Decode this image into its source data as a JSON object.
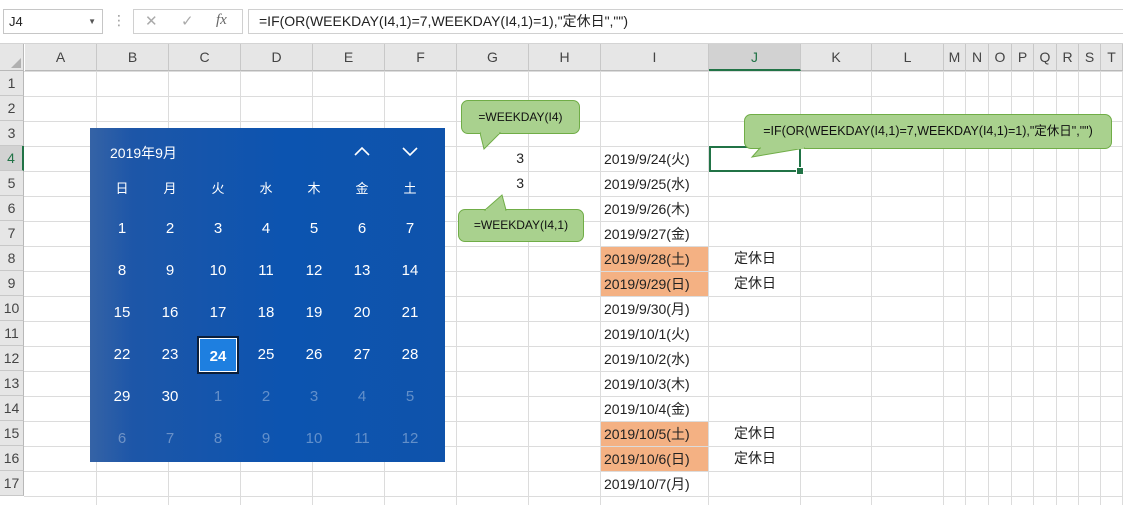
{
  "formula_bar": {
    "name_box": "J4",
    "sep": "⋮",
    "cancel": "✕",
    "enter": "✓",
    "fx": "fx",
    "formula": "=IF(OR(WEEKDAY(I4,1)=7,WEEKDAY(I4,1)=1),\"定休日\",\"\")"
  },
  "columns": [
    "A",
    "B",
    "C",
    "D",
    "E",
    "F",
    "G",
    "H",
    "I",
    "J",
    "K",
    "L",
    "M",
    "N",
    "O",
    "P",
    "Q",
    "R",
    "S",
    "T"
  ],
  "rows": [
    "1",
    "2",
    "3",
    "4",
    "5",
    "6",
    "7",
    "8",
    "9",
    "10",
    "11",
    "12",
    "13",
    "14",
    "15",
    "16",
    "17"
  ],
  "selected_cell": "J4",
  "cells": {
    "G4": "3",
    "G5": "3",
    "dates": [
      "2019/9/24(火)",
      "2019/9/25(水)",
      "2019/9/26(木)",
      "2019/9/27(金)",
      "2019/9/28(土)",
      "2019/9/29(日)",
      "2019/9/30(月)",
      "2019/10/1(火)",
      "2019/10/2(水)",
      "2019/10/3(木)",
      "2019/10/4(金)",
      "2019/10/5(土)",
      "2019/10/6(日)",
      "2019/10/7(月)"
    ],
    "holiday_label": "定休日",
    "holiday_rows": [
      8,
      9,
      15,
      16
    ],
    "holiday_fill": "#f4b183"
  },
  "calendar": {
    "title": "2019年9月",
    "weekdays": [
      "日",
      "月",
      "火",
      "水",
      "木",
      "金",
      "土"
    ],
    "weeks": [
      [
        "1",
        "2",
        "3",
        "4",
        "5",
        "6",
        "7"
      ],
      [
        "8",
        "9",
        "10",
        "11",
        "12",
        "13",
        "14"
      ],
      [
        "15",
        "16",
        "17",
        "18",
        "19",
        "20",
        "21"
      ],
      [
        "22",
        "23",
        "24",
        "25",
        "26",
        "27",
        "28"
      ],
      [
        "29",
        "30",
        "1",
        "2",
        "3",
        "4",
        "5"
      ],
      [
        "6",
        "7",
        "8",
        "9",
        "10",
        "11",
        "12"
      ]
    ],
    "today": "24",
    "up_icon": "chevron-up-icon",
    "down_icon": "chevron-down-icon",
    "background": "#0c54b0",
    "today_color": "#1e7fe0"
  },
  "callouts": {
    "weekday_i4": "=WEEKDAY(I4)",
    "weekday_i4_1": "=WEEKDAY(I4,1)",
    "if_formula": "=IF(OR(WEEKDAY(I4,1)=7,WEEKDAY(I4,1)=1),\"定休日\",\"\")",
    "fill": "#a9d18e",
    "border": "#70ad47"
  },
  "theme": {
    "excel_green": "#217346"
  }
}
